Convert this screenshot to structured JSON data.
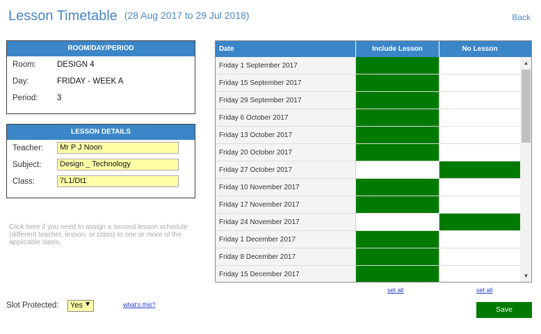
{
  "header": {
    "title": "Lesson Timetable",
    "date_range": "(28 Aug 2017 to 29 Jul 2018)",
    "back_label": "Back"
  },
  "room_panel": {
    "title": "ROOM/DAY/PERIOD",
    "rows": [
      {
        "label": "Room:",
        "value": "DESIGN 4"
      },
      {
        "label": "Day:",
        "value": "FRIDAY - WEEK A"
      },
      {
        "label": "Period:",
        "value": "3"
      }
    ]
  },
  "lesson_panel": {
    "title": "LESSON DETAILS",
    "rows": [
      {
        "label": "Teacher:",
        "value": "Mr P J Noon"
      },
      {
        "label": "Subject:",
        "value": "Design _ Technology"
      },
      {
        "label": "Class:",
        "value": "7L1/Dt1"
      }
    ]
  },
  "note": "Click here if you need to assign a second lesson schedule (different teacher, lesson, or class) to one or more of the applicable dates.",
  "slot": {
    "label": "Slot Protected:",
    "value": "Yes",
    "whats_this": "what's this?"
  },
  "grid": {
    "headers": {
      "date": "Date",
      "include": "Include Lesson",
      "no": "No Lesson"
    },
    "rows": [
      {
        "date": "Friday 1 September 2017",
        "include": true
      },
      {
        "date": "Friday 15 September 2017",
        "include": true
      },
      {
        "date": "Friday 29 September 2017",
        "include": true
      },
      {
        "date": "Friday 6 October 2017",
        "include": true
      },
      {
        "date": "Friday 13 October 2017",
        "include": true
      },
      {
        "date": "Friday 20 October 2017",
        "include": true
      },
      {
        "date": "Friday 27 October 2017",
        "include": false
      },
      {
        "date": "Friday 10 November 2017",
        "include": true
      },
      {
        "date": "Friday 17 November 2017",
        "include": true
      },
      {
        "date": "Friday 24 November 2017",
        "include": false
      },
      {
        "date": "Friday 1 December 2017",
        "include": true
      },
      {
        "date": "Friday 8 December 2017",
        "include": true
      },
      {
        "date": "Friday 15 December 2017",
        "include": true
      }
    ],
    "set_all_include": "set all",
    "set_all_no": "set all"
  },
  "save_label": "Save",
  "colors": {
    "accent": "#3b86c8",
    "selected": "#007a00",
    "field_bg": "#ffffa8",
    "title": "#4a86c5"
  },
  "icons": {
    "scroll_up": "triangle-up-icon",
    "scroll_down": "triangle-down-icon",
    "dropdown": "triangle-down-icon"
  }
}
